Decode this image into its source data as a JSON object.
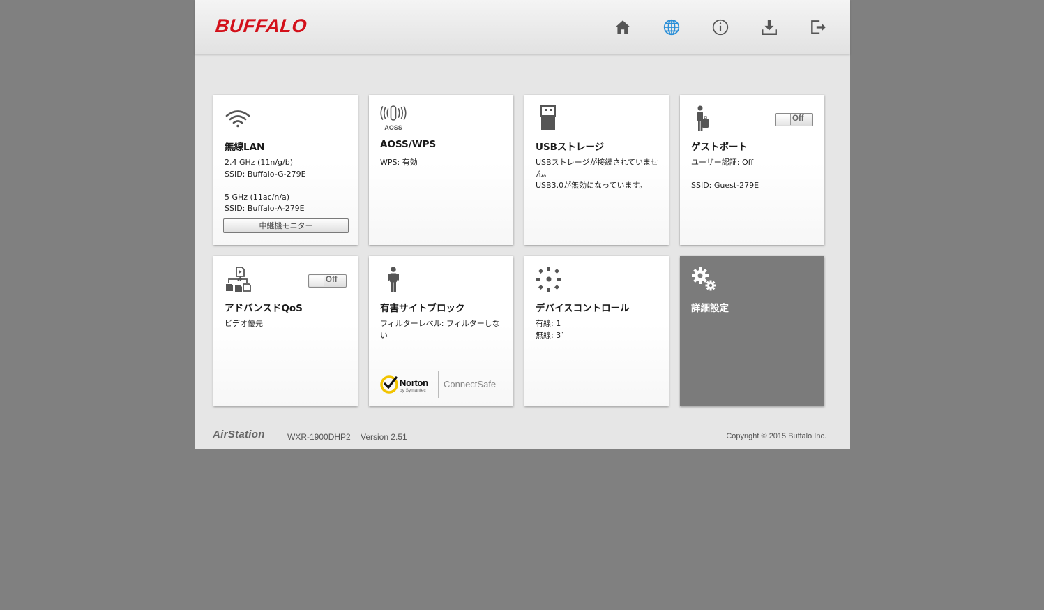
{
  "header": {
    "logo": "BUFFALO",
    "nav": [
      {
        "icon": "home-icon",
        "color": "#555555"
      },
      {
        "icon": "globe-icon",
        "color": "#2a8fd8"
      },
      {
        "icon": "info-icon",
        "color": "#555555"
      },
      {
        "icon": "download-icon",
        "color": "#555555"
      },
      {
        "icon": "logout-icon",
        "color": "#555555"
      }
    ]
  },
  "tiles": {
    "wireless": {
      "title": "無線LAN",
      "lines": [
        "2.4 GHz (11n/g/b)",
        "SSID: Buffalo-G-279E",
        "",
        "5 GHz (11ac/n/a)",
        "SSID: Buffalo-A-279E"
      ],
      "button": "中継機モニター"
    },
    "aoss": {
      "title": "AOSS/WPS",
      "icon_text": "AOSS",
      "lines": [
        "WPS: 有効"
      ]
    },
    "usb": {
      "title": "USBストレージ",
      "lines": [
        "USBストレージが接続されていません。",
        "USB3.0が無効になっています。"
      ]
    },
    "guest": {
      "title": "ゲストポート",
      "toggle": "Off",
      "lines": [
        "ユーザー認証: Off",
        "",
        "SSID: Guest-279E"
      ]
    },
    "qos": {
      "title": "アドバンスドQoS",
      "toggle": "Off",
      "lines": [
        "ビデオ優先"
      ]
    },
    "filter": {
      "title": "有害サイトブロック",
      "lines": [
        "フィルターレベル: フィルターしない"
      ],
      "logo_name": "Norton",
      "logo_sub": "by Symantec",
      "logo_service": "ConnectSafe"
    },
    "devices": {
      "title": "デバイスコントロール",
      "lines": [
        "有線: 1",
        "無線: 3`"
      ]
    },
    "advanced": {
      "title": "詳細設定"
    }
  },
  "footer": {
    "brand": "AirStation",
    "model": "WXR-1900DHP2",
    "version": "Version 2.51",
    "copyright": "Copyright © 2015 Buffalo Inc."
  },
  "colors": {
    "brand_red": "#d3101a",
    "accent_blue": "#2a8fd8",
    "dark_tile": "#7b7b7b",
    "norton_yellow": "#f2c400"
  }
}
